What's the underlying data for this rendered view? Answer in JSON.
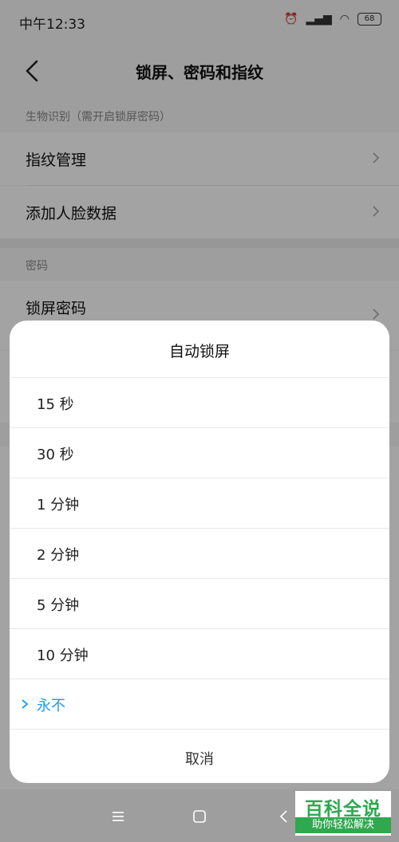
{
  "status_bar": {
    "time": "中午12:33",
    "battery": "68"
  },
  "header": {
    "title": "锁屏、密码和指纹"
  },
  "sections": {
    "biometric_label": "生物识别（需开启锁屏密码）",
    "fingerprint": "指纹管理",
    "face": "添加人脸数据",
    "password_label": "密码",
    "lock_password": "锁屏密码"
  },
  "sheet": {
    "title": "自动锁屏",
    "options": [
      "15 秒",
      "30 秒",
      "1 分钟",
      "2 分钟",
      "5 分钟",
      "10 分钟",
      "永不"
    ],
    "selected": "永不",
    "cancel": "取消"
  },
  "watermark": {
    "main": "百科全说",
    "sub": "助你轻松解决"
  },
  "colors": {
    "accent": "#1a9bf0",
    "watermark": "#2fa84f"
  }
}
